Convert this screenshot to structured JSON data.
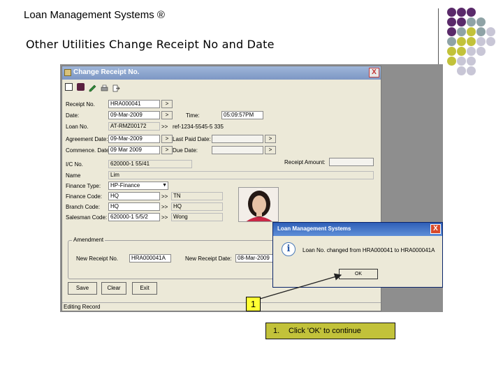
{
  "slide": {
    "title": "Loan Management Systems ®",
    "subtitle": "Other Utilities Change Receipt No and Date"
  },
  "deco": {
    "colors": {
      "purple": "#5a2a6a",
      "slate": "#8fa3a6",
      "olive": "#c2c23a",
      "lavender": "#c8c6d6"
    }
  },
  "window": {
    "title": "Change Receipt No.",
    "close_label": "X",
    "toolbar_icons": [
      "new-icon",
      "delete-icon",
      "edit-icon",
      "print-icon",
      "exit-icon"
    ],
    "fields": {
      "receipt_no": {
        "label": "Receipt No.",
        "value": "HRA000041"
      },
      "date": {
        "label": "Date:",
        "value": "09-Mar-2009"
      },
      "time": {
        "label": "Time:",
        "value": "05:09:57PM"
      },
      "loan_no": {
        "label": "Loan No.",
        "value": "AT-RMZ00172",
        "extra": "ref-1234-5545-5 335"
      },
      "agreement_date": {
        "label": "Agreement Date:",
        "value": "09-Mar-2009"
      },
      "last_paid_date": {
        "label": "Last Paid Date:",
        "value": ""
      },
      "commence_date": {
        "label": "Commence. Date:",
        "value": "09 Mar 2009"
      },
      "due_date": {
        "label": "Due Date:",
        "value": ""
      },
      "receipt_amount": {
        "label": "Receipt Amount:",
        "value": ""
      },
      "ic_no": {
        "label": "I/C No.",
        "value": "620000-1 55/41"
      },
      "name": {
        "label": "Name",
        "value": "Lim"
      },
      "finance_type": {
        "label": "Finance Type:",
        "value": "HP-Finance"
      },
      "finance_code": {
        "label": "Finance Code:",
        "value": "HQ",
        "extra": "TN"
      },
      "branch_code": {
        "label": "Branch Code:",
        "value": "HQ",
        "extra": "HQ"
      },
      "salesman_code": {
        "label": "Salesman Code:",
        "value": "620000-1 5/5/2",
        "extra": "Wong"
      }
    },
    "amendment": {
      "legend": "Amendment",
      "new_receipt_no": {
        "label": "New Receipt No.",
        "value": "HRA000041A"
      },
      "new_receipt_date": {
        "label": "New Receipt Date:",
        "value": "08-Mar-2009"
      }
    },
    "buttons": {
      "save": "Save",
      "clear": "Clear",
      "exit": "Exit"
    },
    "spin_label": ">",
    "double_arrow": ">>",
    "status": "Editing Record"
  },
  "dialog": {
    "title": "Loan Management Systems",
    "close_label": "X",
    "icon": "info-icon",
    "message": "Loan No. changed from HRA000041 to HRA000041A",
    "ok_label": "OK"
  },
  "callout": {
    "badge": "1",
    "number": "1.",
    "text": "Click 'OK' to continue"
  }
}
